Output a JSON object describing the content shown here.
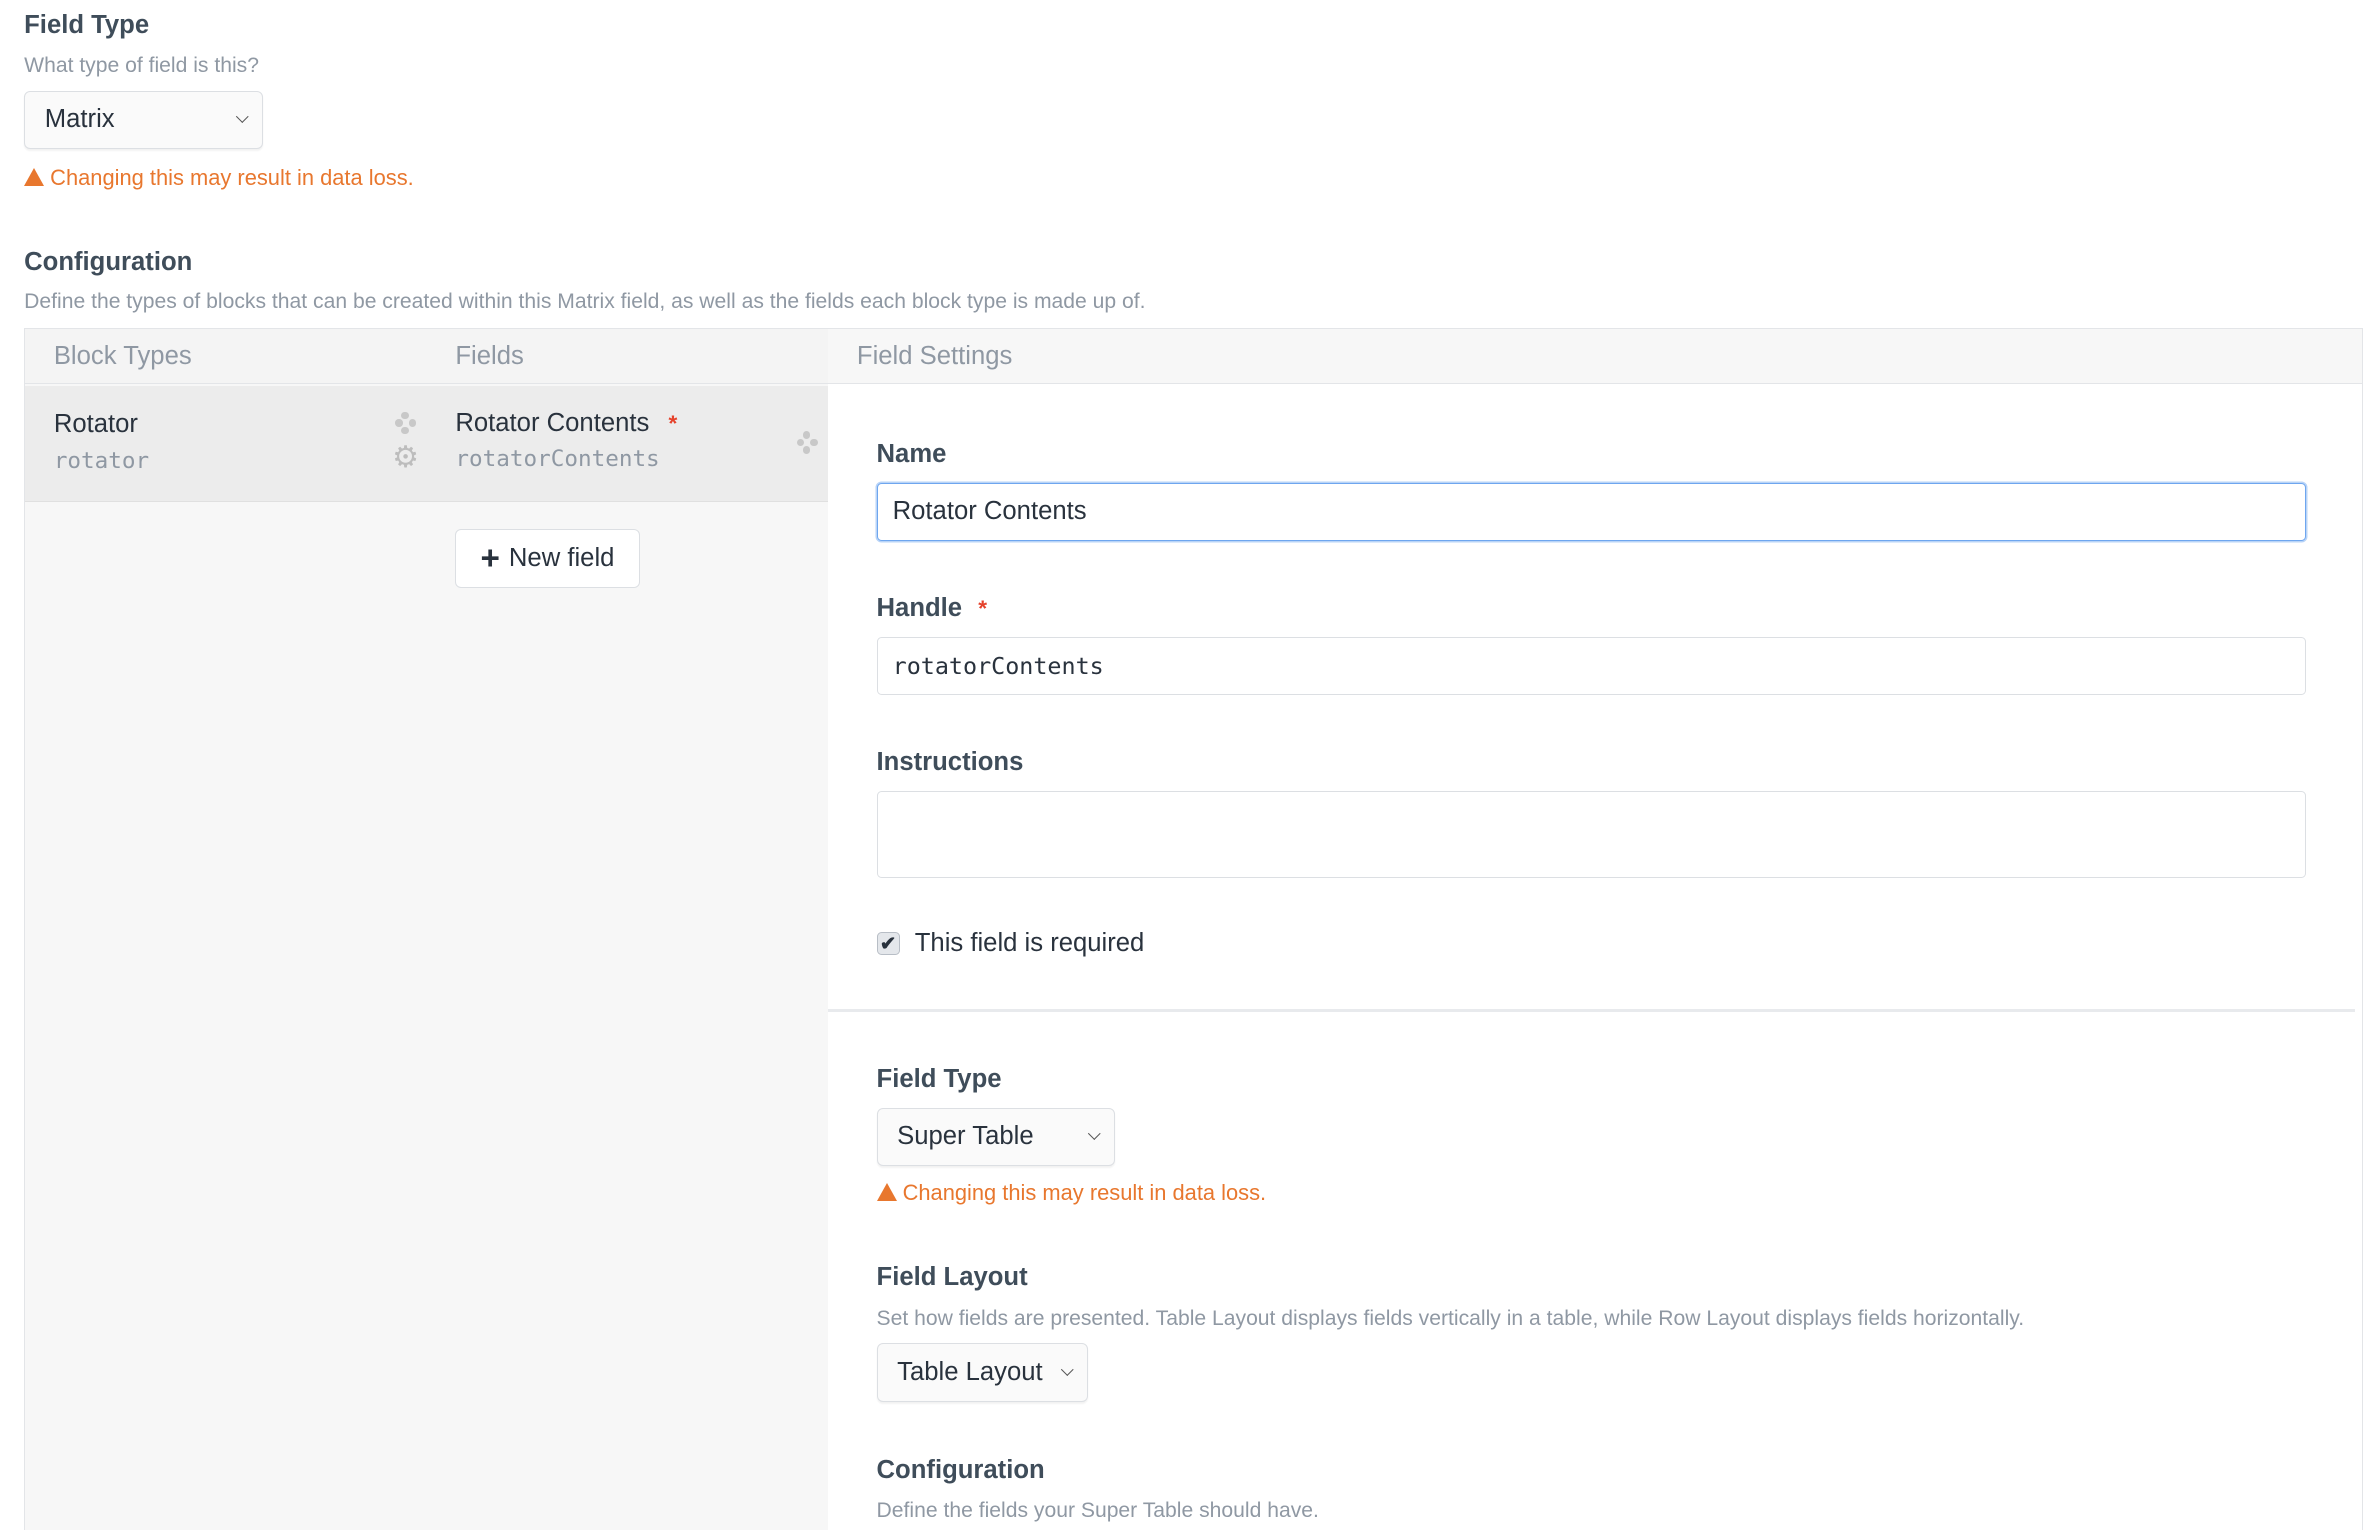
{
  "field_type": {
    "heading": "Field Type",
    "instructions": "What type of field is this?",
    "value": "Matrix",
    "warning": "Changing this may result in data loss."
  },
  "configuration": {
    "heading": "Configuration",
    "instructions": "Define the types of blocks that can be created within this Matrix field, as well as the fields each block type is made up of."
  },
  "columns": {
    "block_types": "Block Types",
    "fields": "Fields",
    "field_settings": "Field Settings"
  },
  "block_types": [
    {
      "name": "Rotator",
      "handle": "rotator"
    }
  ],
  "fields": [
    {
      "name": "Rotator Contents",
      "handle": "rotatorContents",
      "required": true
    }
  ],
  "new_field_label": "New field",
  "settings": {
    "name_label": "Name",
    "name_value": "Rotator Contents",
    "handle_label": "Handle",
    "handle_value": "rotatorContents",
    "instructions_label": "Instructions",
    "instructions_value": "",
    "required_label": "This field is required",
    "required_checked": true,
    "field_type_label": "Field Type",
    "field_type_value": "Super Table",
    "field_type_warning": "Changing this may result in data loss.",
    "field_layout_label": "Field Layout",
    "field_layout_instructions": "Set how fields are presented. Table Layout displays fields vertically in a table, while Row Layout displays fields horizontally.",
    "field_layout_value": "Table Layout",
    "config_label": "Configuration",
    "config_instructions": "Define the fields your Super Table should have."
  },
  "colors": {
    "warning": "#e8772e",
    "required": "#e5422b",
    "focus": "#6ea6ef"
  }
}
